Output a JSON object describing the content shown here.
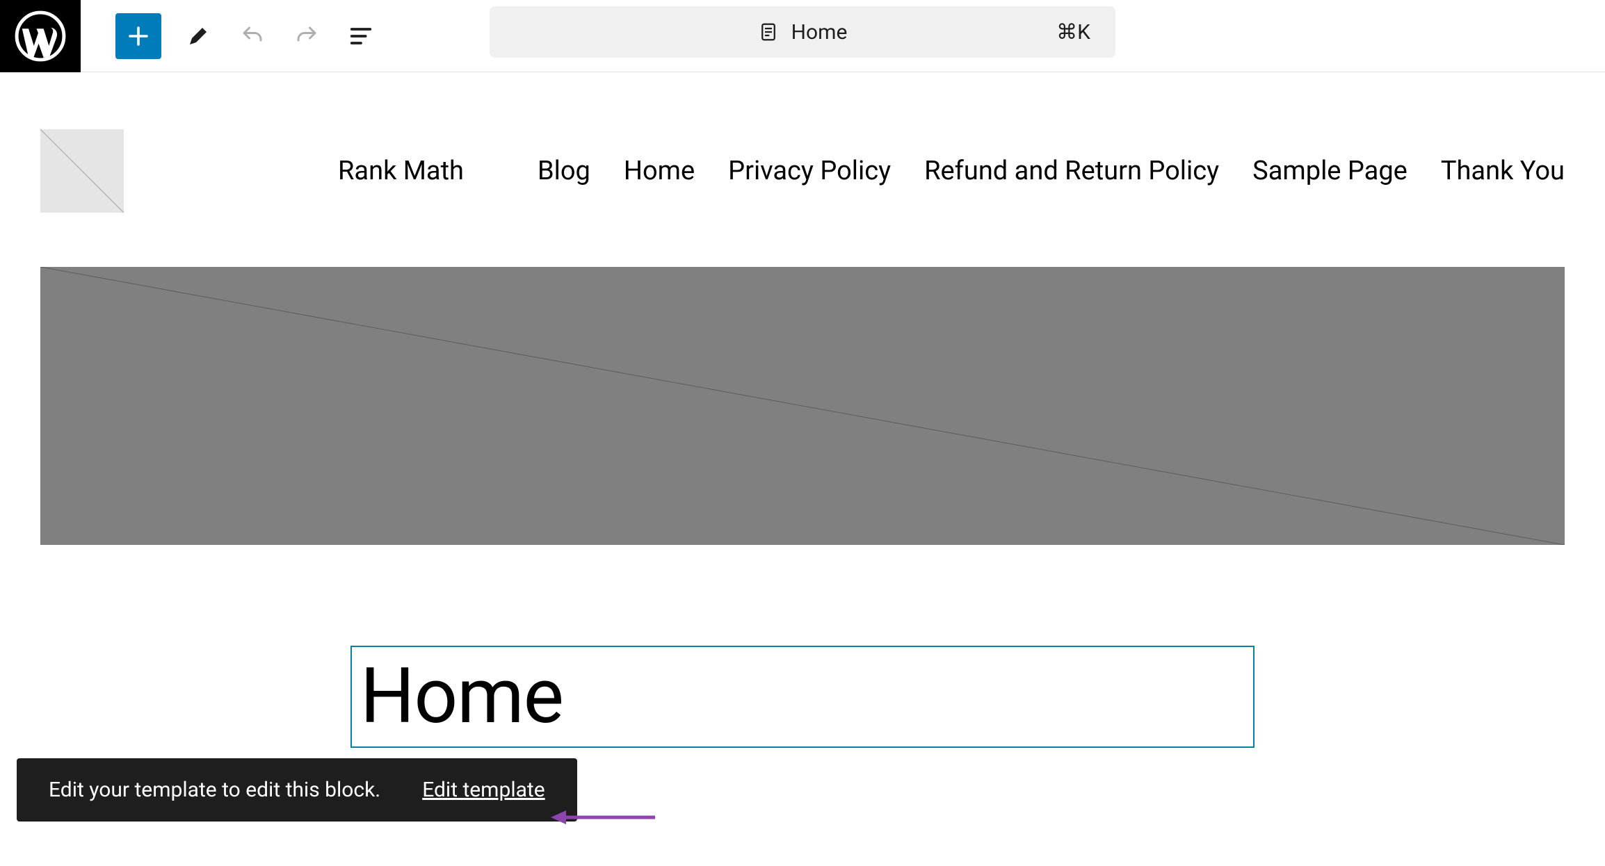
{
  "toolbar": {
    "center_label": "Home",
    "shortcut": "⌘K"
  },
  "site": {
    "title": "Rank Math",
    "nav": [
      {
        "label": "Blog"
      },
      {
        "label": "Home"
      },
      {
        "label": "Privacy Policy"
      },
      {
        "label": "Refund and Return Policy"
      },
      {
        "label": "Sample Page"
      },
      {
        "label": "Thank You"
      }
    ]
  },
  "page": {
    "title": "Home"
  },
  "snackbar": {
    "message": "Edit your template to edit this block.",
    "action": "Edit template"
  },
  "icons": {
    "wp_logo": "wordpress-logo-icon",
    "add": "plus-icon",
    "tools": "pencil-icon",
    "undo": "undo-icon",
    "redo": "redo-icon",
    "outline": "list-view-icon",
    "page": "page-icon"
  }
}
